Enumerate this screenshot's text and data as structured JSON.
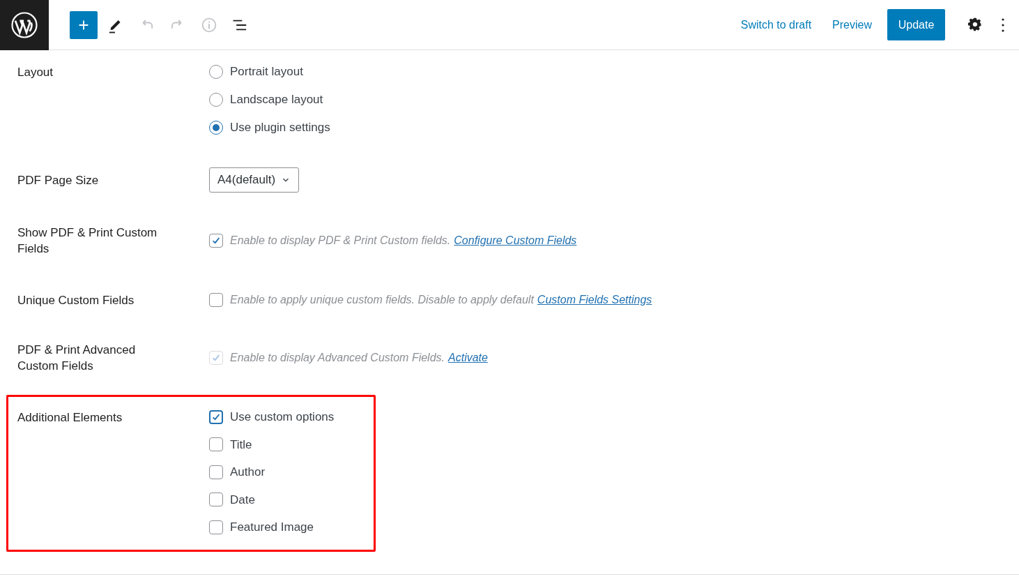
{
  "toolbar": {
    "tools": [
      {
        "kind": "add",
        "disabled": false
      },
      {
        "kind": "edit",
        "disabled": false
      },
      {
        "kind": "undo",
        "disabled": true
      },
      {
        "kind": "redo",
        "disabled": true
      },
      {
        "kind": "info",
        "disabled": true
      },
      {
        "kind": "outline",
        "disabled": false
      }
    ],
    "switch_to_draft": "Switch to draft",
    "preview": "Preview",
    "update": "Update"
  },
  "settings": [
    {
      "kind": "radio_group",
      "label": "Layout",
      "options": [
        {
          "label": "Portrait layout",
          "selected": false
        },
        {
          "label": "Landscape layout",
          "selected": false
        },
        {
          "label": "Use plugin settings",
          "selected": true
        }
      ]
    },
    {
      "kind": "select",
      "label": "PDF Page Size",
      "value": "A4(default)"
    },
    {
      "kind": "checkbox",
      "label": "Show PDF & Print Custom Fields",
      "checked": true,
      "disabled": false,
      "description": "Enable to display PDF & Print Custom fields.",
      "link": "Configure Custom Fields"
    },
    {
      "kind": "checkbox",
      "label": "Unique Custom Fields",
      "checked": false,
      "disabled": false,
      "description": "Enable to apply unique custom fields. Disable to apply default",
      "link": "Custom Fields Settings"
    },
    {
      "kind": "checkbox",
      "label": "PDF & Print Advanced Custom Fields",
      "checked": true,
      "disabled": true,
      "description": "Enable to display Advanced Custom Fields.",
      "link": "Activate"
    },
    {
      "kind": "checkbox_group",
      "label": "Additional Elements",
      "highlighted": true,
      "options": [
        {
          "label": "Use custom options",
          "checked": true
        },
        {
          "label": "Title",
          "checked": false
        },
        {
          "label": "Author",
          "checked": false
        },
        {
          "label": "Date",
          "checked": false
        },
        {
          "label": "Featured Image",
          "checked": false
        }
      ]
    }
  ]
}
